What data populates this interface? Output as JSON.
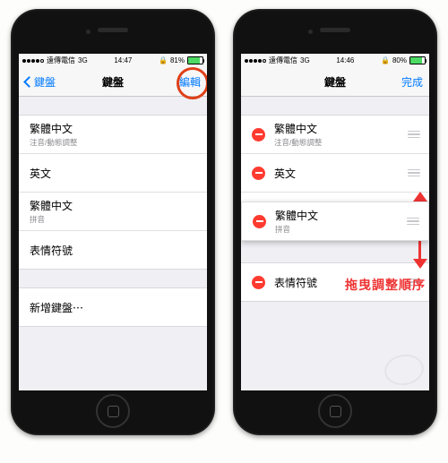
{
  "left": {
    "status": {
      "carrier": "遠傳電信",
      "net": "3G",
      "time": "14:47",
      "batt_pct": "81%",
      "batt_fill": 81
    },
    "nav": {
      "back": "鍵盤",
      "title": "鍵盤",
      "action": "編輯"
    },
    "keyboards": [
      {
        "title": "繁體中文",
        "sub": "注音/動態調整"
      },
      {
        "title": "英文",
        "sub": ""
      },
      {
        "title": "繁體中文",
        "sub": "拼音"
      },
      {
        "title": "表情符號",
        "sub": ""
      }
    ],
    "add": "新增鍵盤⋯"
  },
  "right": {
    "status": {
      "carrier": "遠傳電信",
      "net": "3G",
      "time": "14:46",
      "batt_pct": "80%",
      "batt_fill": 80
    },
    "nav": {
      "title": "鍵盤",
      "action": "完成"
    },
    "keyboards": [
      {
        "title": "繁體中文",
        "sub": "注音/動態調整"
      },
      {
        "title": "英文",
        "sub": ""
      },
      {
        "title": "繁體中文",
        "sub": "拼音"
      },
      {
        "title": "表情符號",
        "sub": ""
      }
    ],
    "annotation": "拖曳調整順序"
  },
  "icons": {
    "orientation_lock": "🔒"
  }
}
